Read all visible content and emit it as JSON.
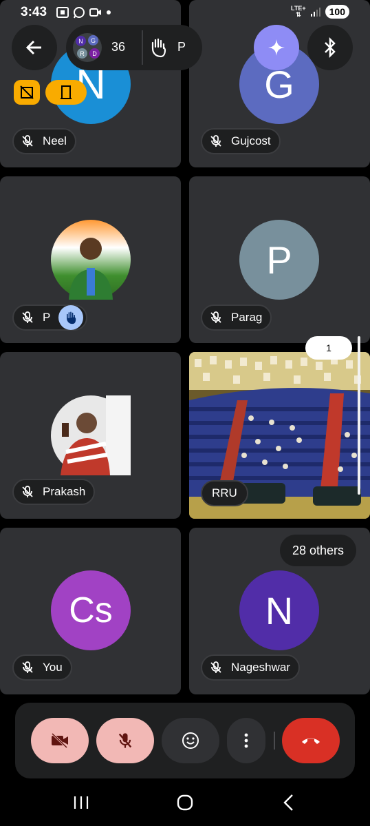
{
  "status_bar": {
    "time": "3:43",
    "network": "LTE+",
    "battery": "100"
  },
  "top_bar": {
    "participant_count": "36",
    "avatar_stack": [
      "N",
      "G",
      "R",
      "D"
    ],
    "raised_hand_initial": "P"
  },
  "tiles": [
    {
      "name": "Neel",
      "initial": "N",
      "color": "#1a8fd6"
    },
    {
      "name": "Gujcost",
      "initial": "G",
      "color": "#5c6bc0"
    },
    {
      "name": "P",
      "initial": "",
      "color": "#4a7c3a"
    },
    {
      "name": "Parag",
      "initial": "P",
      "color": "#78909c"
    },
    {
      "name": "Prakash",
      "initial": "",
      "color": "#b04030"
    },
    {
      "name": "RRU",
      "initial": "",
      "color": "#2a3a8a"
    },
    {
      "name": "You",
      "initial": "Cs",
      "color": "#a142c4"
    },
    {
      "name": "Nageshwar",
      "initial": "N",
      "color": "#512da8"
    }
  ],
  "others_label": "28 others",
  "presentation_count": "1",
  "colors": {
    "tile_bg": "#303134",
    "end_call": "#d93025",
    "muted_btn": "#f2b8b5"
  }
}
